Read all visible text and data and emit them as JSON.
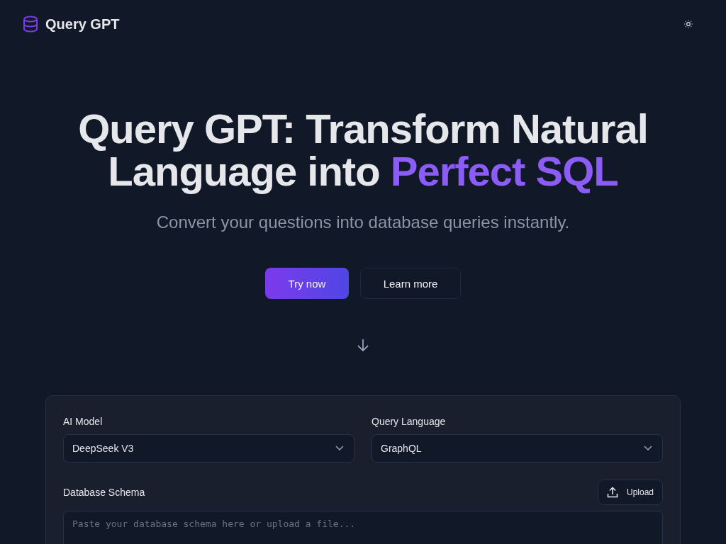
{
  "header": {
    "brand": "Query GPT"
  },
  "hero": {
    "title": "Query GPT: Transform Natural Language into",
    "title_highlight": "Perfect SQL",
    "subtitle": "Convert your questions into database queries instantly.",
    "buttons": [
      {
        "label": "Try now",
        "kind": "primary"
      },
      {
        "label": "Learn more",
        "kind": "secondary"
      }
    ]
  },
  "form": {
    "selects": [
      {
        "label": "AI Model",
        "value": "DeepSeek V3"
      },
      {
        "label": "Query Language",
        "value": "GraphQL"
      }
    ],
    "schema": {
      "label": "Database Schema",
      "upload_button": "Upload",
      "placeholder": "Paste your database schema here or upload a file..."
    }
  }
}
